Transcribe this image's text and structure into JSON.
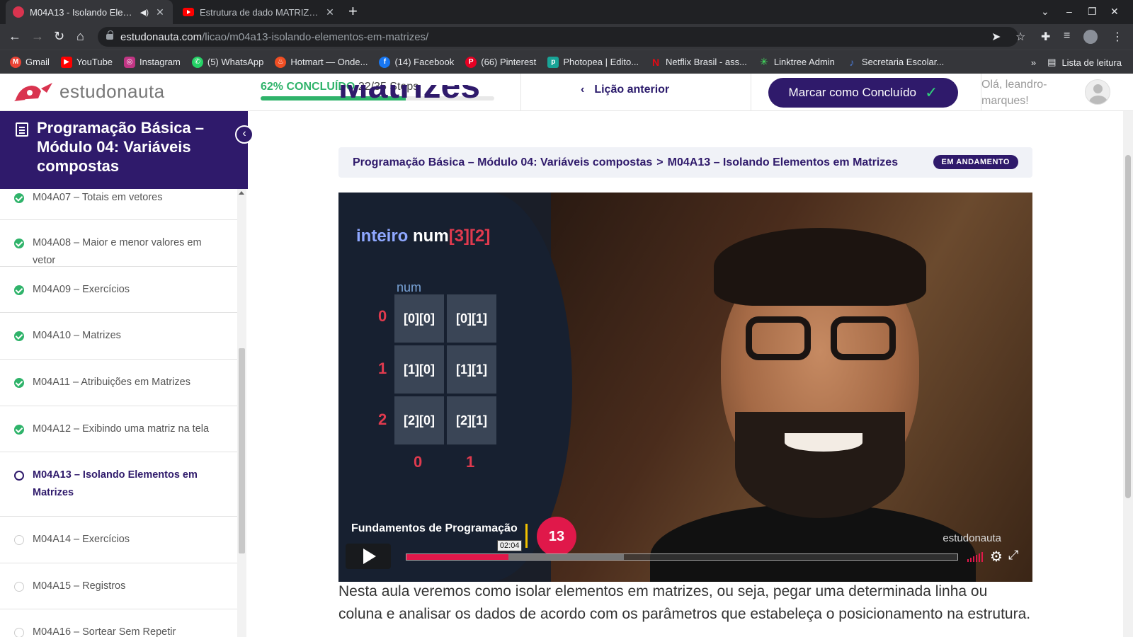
{
  "browser": {
    "tabs": [
      {
        "title": "M04A13 - Isolando Elementos em Matrizes",
        "active": true,
        "audio": true
      },
      {
        "title": "Estrutura de dado MATRIZ (array)",
        "active": false
      }
    ],
    "url_host": "estudonauta.com",
    "url_path": "/licao/m04a13-isolando-elementos-em-matrizes/",
    "bookmarks": [
      {
        "label": "Gmail",
        "icon": "gmail-icon",
        "color": "#ea4335"
      },
      {
        "label": "YouTube",
        "icon": "youtube-icon",
        "color": "#ff0000"
      },
      {
        "label": "Instagram",
        "icon": "instagram-icon",
        "color": "#c13584"
      },
      {
        "label": "(5) WhatsApp",
        "icon": "whatsapp-icon",
        "color": "#25d366"
      },
      {
        "label": "Hotmart — Onde...",
        "icon": "hotmart-icon",
        "color": "#f04e23"
      },
      {
        "label": "(14) Facebook",
        "icon": "facebook-icon",
        "color": "#1877f2"
      },
      {
        "label": "(66) Pinterest",
        "icon": "pinterest-icon",
        "color": "#e60023"
      },
      {
        "label": "Photopea | Edito...",
        "icon": "photopea-icon",
        "color": "#18a497"
      },
      {
        "label": "Netflix Brasil - ass...",
        "icon": "netflix-icon",
        "color": "#e50914"
      },
      {
        "label": "Linktree Admin",
        "icon": "linktree-icon",
        "color": "#43e660"
      },
      {
        "label": "Secretaria Escolar...",
        "icon": "secretaria-icon",
        "color": "#4a7bd8"
      }
    ],
    "reading_list": "Lista de leitura"
  },
  "header": {
    "logo_text": "estudonauta",
    "progress_pct_label": "62% CONCLUÍDO",
    "progress_steps": "22/35 Steps",
    "progress_value": 0.62,
    "prev_lesson": "Lição anterior",
    "mark_complete": "Marcar como Concluído",
    "greeting": "Olá, leandro-marques!"
  },
  "sidebar": {
    "course_title": "Programação Básica – Módulo 04: Variáveis compostas",
    "lessons": [
      {
        "label": "M04A07 – Totais em vetores",
        "status": "done"
      },
      {
        "label": "M04A08 – Maior e menor valores em vetor",
        "status": "done"
      },
      {
        "label": "M04A09 – Exercícios",
        "status": "done"
      },
      {
        "label": "M04A10 – Matrizes",
        "status": "done"
      },
      {
        "label": "M04A11 – Atribuições em Matrizes",
        "status": "done"
      },
      {
        "label": "M04A12 – Exibindo uma matriz na tela",
        "status": "done"
      },
      {
        "label": "M04A13 – Isolando Elementos em Matrizes",
        "status": "current"
      },
      {
        "label": "M04A14 – Exercícios",
        "status": "todo"
      },
      {
        "label": "M04A15 – Registros",
        "status": "todo"
      },
      {
        "label": "M04A16 – Sortear Sem Repetir",
        "status": "todo"
      }
    ]
  },
  "main": {
    "heading": "Matrizes",
    "breadcrumb_course": "Programação Básica – Módulo 04: Variáveis compostas",
    "breadcrumb_sep": ">",
    "breadcrumb_lesson": "M04A13 – Isolando Elementos em Matrizes",
    "status": "EM ANDAMENTO",
    "video": {
      "code_type": "inteiro",
      "code_var": "num",
      "code_dims": "[3][2]",
      "matrix_label": "num",
      "cells": [
        "[0][0]",
        "[0][1]",
        "[1][0]",
        "[1][1]",
        "[2][0]",
        "[2][1]"
      ],
      "row_indices": [
        "0",
        "1",
        "2"
      ],
      "col_indices": [
        "0",
        "1"
      ],
      "lower_third": "Fundamentos de Programação",
      "episode": "13",
      "watermark": "estudonauta",
      "time_tooltip": "02:04",
      "played_fraction": 0.185,
      "buffered_fraction": 0.395
    },
    "description": "Nesta aula veremos como isolar elementos em matrizes, ou seja, pegar uma determinada linha ou coluna e analisar os dados de acordo com os parâmetros que estabeleça o posicionamento na estrutura."
  }
}
